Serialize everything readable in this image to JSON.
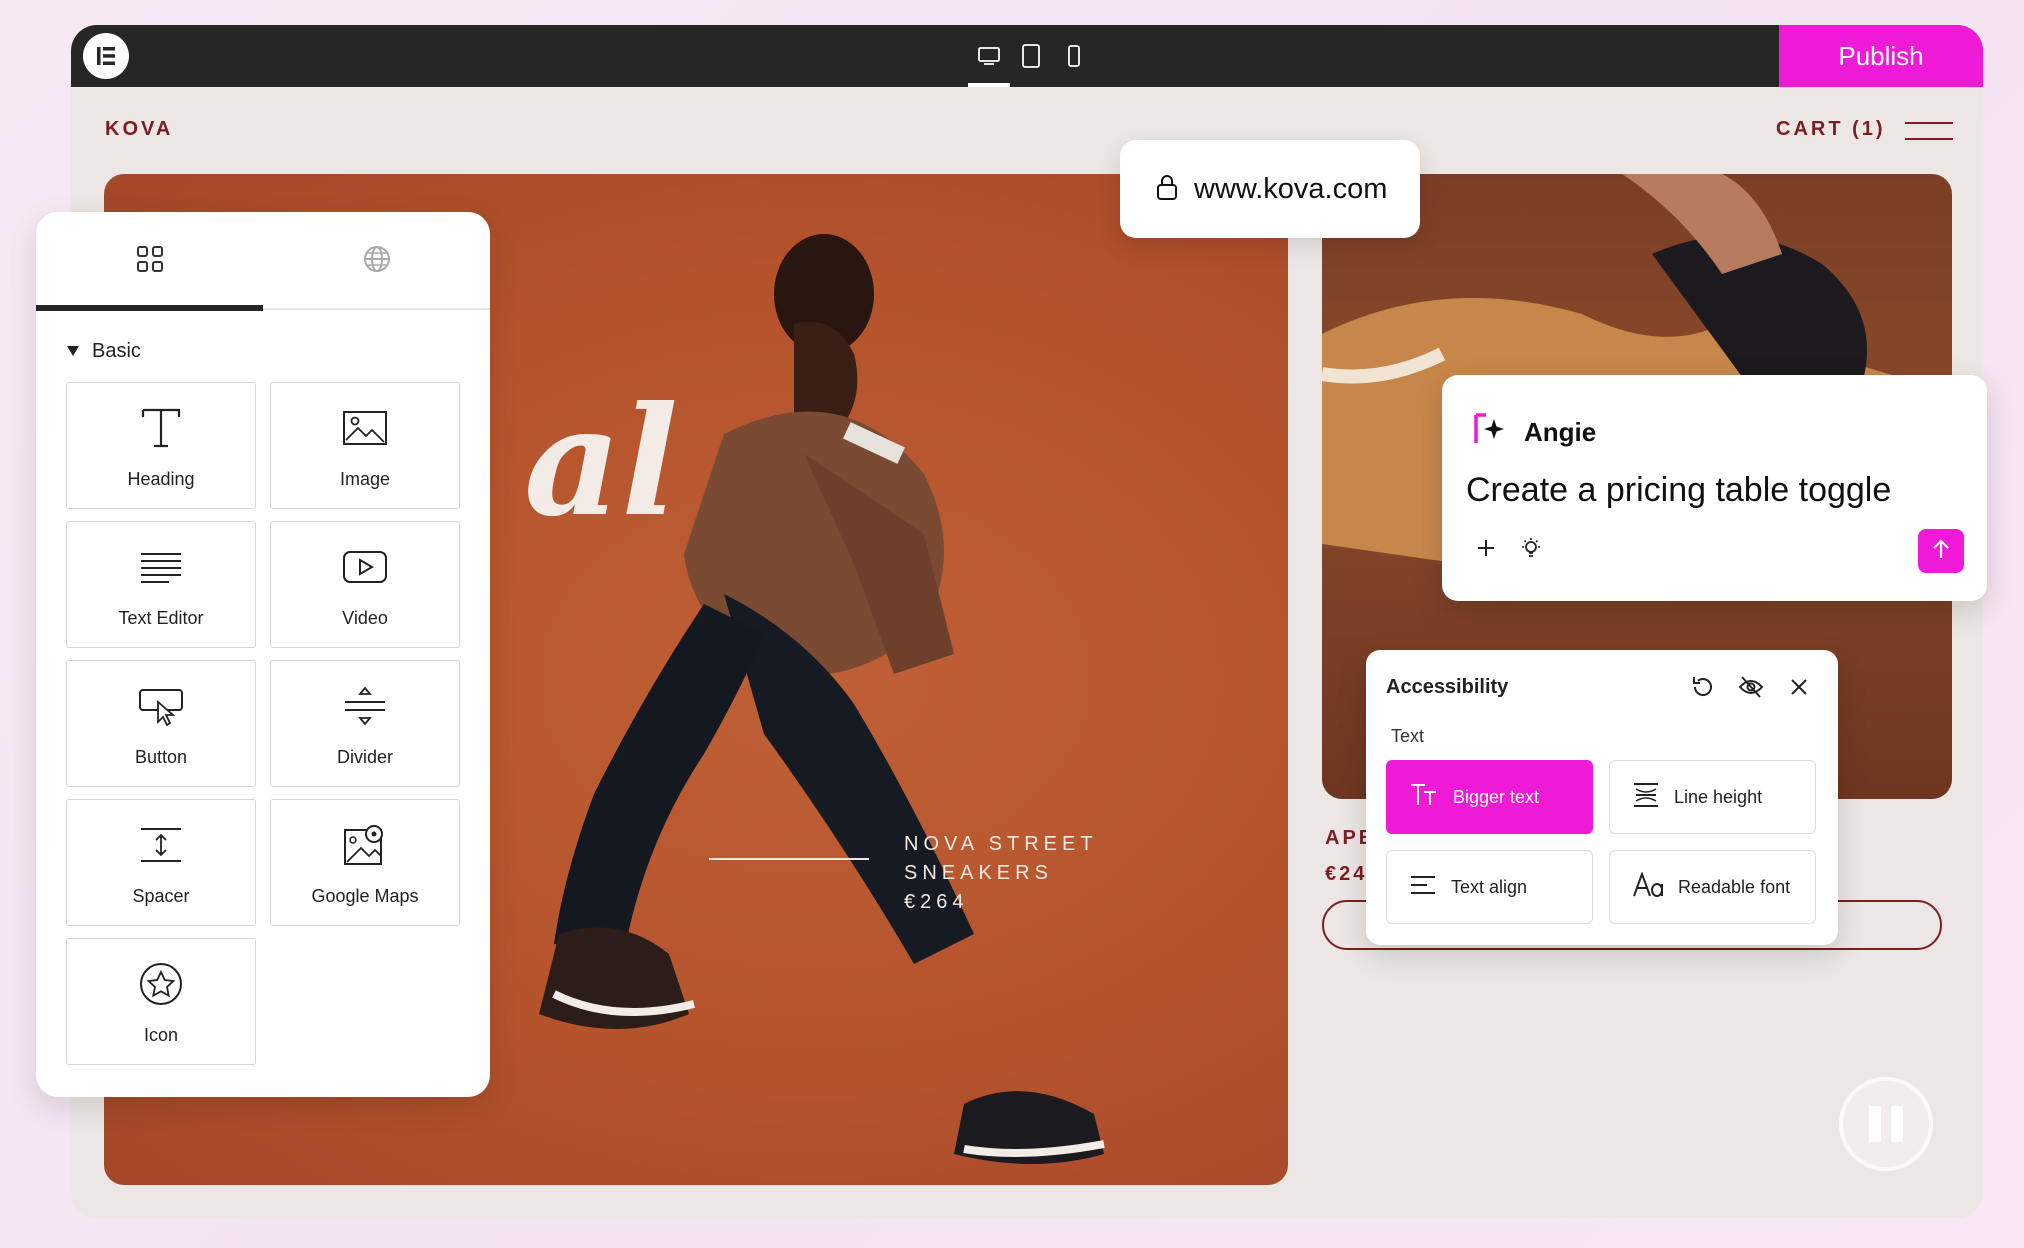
{
  "editor": {
    "publish_label": "Publish",
    "devices": [
      "desktop-icon",
      "tablet-icon",
      "mobile-icon"
    ]
  },
  "site": {
    "logo": "KOVA",
    "cart_label": "CART (1)",
    "url": "www.kova.com",
    "hero": {
      "script_text": "al",
      "caption_lines": [
        "NOVA STREET",
        "SNEAKERS",
        "€264"
      ]
    },
    "product2": {
      "name_partial": "APE",
      "price_partial": "€24"
    }
  },
  "widgets_panel": {
    "tabs": [
      "grid-icon",
      "globe-icon"
    ],
    "section_label": "Basic",
    "items": [
      {
        "label": "Heading",
        "icon": "heading-icon"
      },
      {
        "label": "Image",
        "icon": "image-icon"
      },
      {
        "label": "Text Editor",
        "icon": "text-editor-icon"
      },
      {
        "label": "Video",
        "icon": "video-icon"
      },
      {
        "label": "Button",
        "icon": "button-icon"
      },
      {
        "label": "Divider",
        "icon": "divider-icon"
      },
      {
        "label": "Spacer",
        "icon": "spacer-icon"
      },
      {
        "label": "Google Maps",
        "icon": "map-icon"
      },
      {
        "label": "Icon",
        "icon": "star-icon"
      }
    ]
  },
  "angie": {
    "name": "Angie",
    "prompt": "Create a pricing table toggle"
  },
  "accessibility": {
    "title": "Accessibility",
    "section": "Text",
    "options": [
      {
        "label": "Bigger text",
        "active": true
      },
      {
        "label": "Line height",
        "active": false
      },
      {
        "label": "Text align",
        "active": false
      },
      {
        "label": "Readable font",
        "active": false
      }
    ]
  },
  "colors": {
    "accent": "#ee1ad6",
    "brand_text": "#7a1e23",
    "topbar": "#262626",
    "hero_bg": "#b4532c"
  }
}
